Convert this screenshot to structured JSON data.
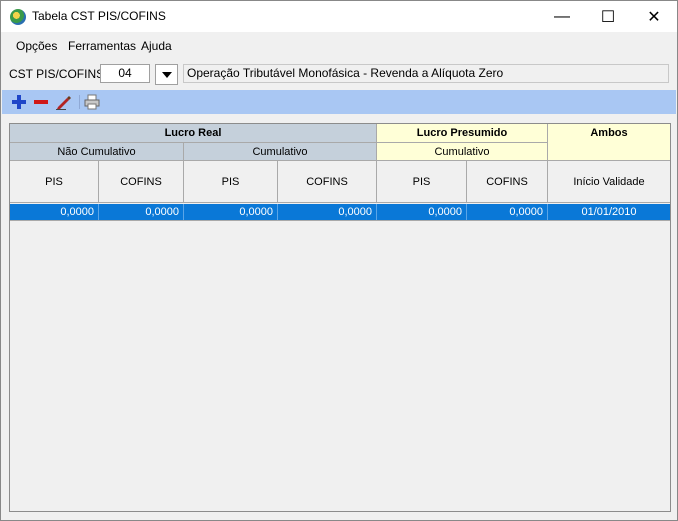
{
  "window": {
    "title": "Tabela CST PIS/COFINS",
    "controls": {
      "minimize": "—",
      "maximize": "☐",
      "close": "✕"
    }
  },
  "menu": [
    "Opções",
    "Ferramentas",
    "Ajuda"
  ],
  "cst": {
    "label": "CST PIS/COFINS:",
    "value": "04",
    "description": "Operação Tributável Monofásica - Revenda a Alíquota Zero"
  },
  "toolbar": {
    "icons": [
      "add-icon",
      "remove-icon",
      "edit-icon",
      "print-icon"
    ]
  },
  "grid": {
    "groups": {
      "lucro_real": "Lucro Real",
      "lucro_presumido": "Lucro Presumido",
      "ambos": "Ambos"
    },
    "subgroups": {
      "nao_cumulativo": "Não Cumulativo",
      "cumulativo_real": "Cumulativo",
      "cumulativo_presumido": "Cumulativo"
    },
    "columns": [
      "PIS",
      "COFINS",
      "PIS",
      "COFINS",
      "PIS",
      "COFINS",
      "Início Validade"
    ],
    "rows": [
      [
        "0,0000",
        "0,0000",
        "0,0000",
        "0,0000",
        "0,0000",
        "0,0000",
        "01/01/2010"
      ]
    ]
  },
  "colors": {
    "selection": "#0a78d7",
    "lucro_real_header": "#c5d0db",
    "lucro_presumido_header": "#ffffd7",
    "toolbar": "#a9c7f3"
  }
}
